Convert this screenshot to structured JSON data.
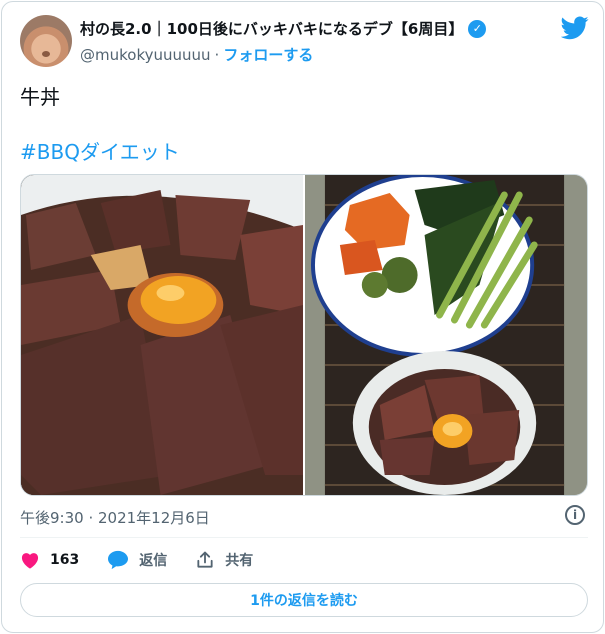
{
  "author": {
    "display_name": "村の長2.0｜100日後にバッキバキになるデブ【6周目】",
    "handle": "@mukokyuuuuuu",
    "separator": "·",
    "follow_label": "フォローする",
    "verified_icon": "verified-badge-icon"
  },
  "tweet": {
    "text": "牛丼",
    "hashtag": "#BBQダイエット",
    "timestamp": "午後9:30 · 2021年12月6日"
  },
  "actions": {
    "like_count": "163",
    "reply_label": "返信",
    "share_label": "共有"
  },
  "read_replies_label": "1件の返信を読む",
  "colors": {
    "accent": "#1d9bf0",
    "like": "#f91880",
    "secondary_text": "#536471"
  }
}
